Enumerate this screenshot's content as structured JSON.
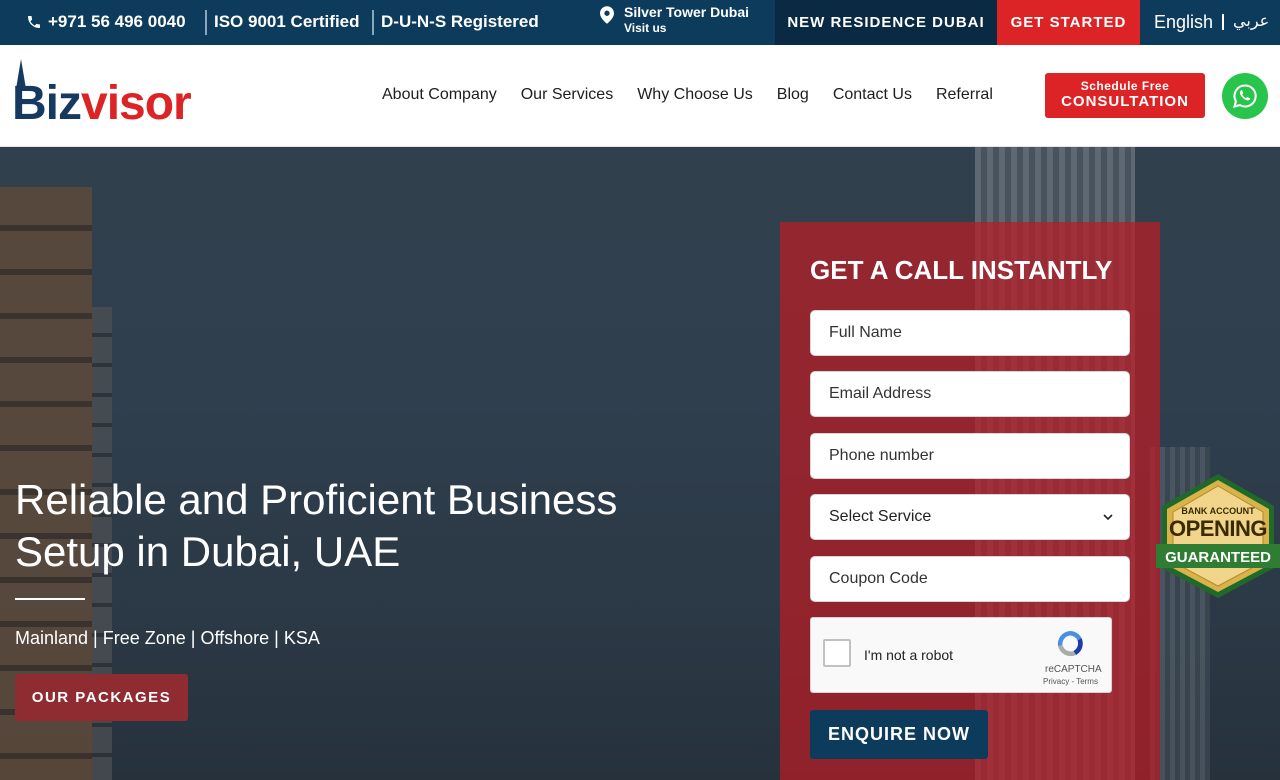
{
  "topbar": {
    "phone": "+971 56 496 0040",
    "iso": "ISO 9001 Certified",
    "duns": "D-U-N-S Registered",
    "location_title": "Silver Tower Dubai",
    "location_sub": "Visit us",
    "new_residence": "NEW RESIDENCE DUBAI",
    "get_started": "GET STARTED",
    "lang_en": "English",
    "lang_ar": "عربي"
  },
  "header": {
    "logo_part1": "Biz",
    "logo_part2": "visor",
    "nav": [
      "About Company",
      "Our Services",
      "Why Choose Us",
      "Blog",
      "Contact Us",
      "Referral"
    ],
    "cta_small": "Schedule Free",
    "cta_big": "CONSULTATION"
  },
  "hero": {
    "title": "Reliable and Proficient Business Setup in Dubai, UAE",
    "subtitle": "Mainland | Free Zone | Offshore | KSA",
    "packages_button": "OUR PACKAGES"
  },
  "form": {
    "title": "GET A CALL INSTANTLY",
    "full_name_placeholder": "Full Name",
    "email_placeholder": "Email Address",
    "phone_placeholder": "Phone number",
    "service_select": "Select Service",
    "coupon_placeholder": "Coupon Code",
    "captcha_label": "I'm not a robot",
    "captcha_brand": "reCAPTCHA",
    "captcha_terms": "Privacy - Terms",
    "submit": "ENQUIRE NOW"
  },
  "badge": {
    "top": "BANK ACCOUNT",
    "mid": "OPENING",
    "bot": "GUARANTEED"
  },
  "colors": {
    "navy": "#0d3b5c",
    "red": "#dc2426",
    "whatsapp": "#29c44b"
  },
  "icons": [
    "phone-icon",
    "location-pin-icon",
    "whatsapp-icon",
    "chevron-down-icon",
    "recaptcha-icon"
  ]
}
